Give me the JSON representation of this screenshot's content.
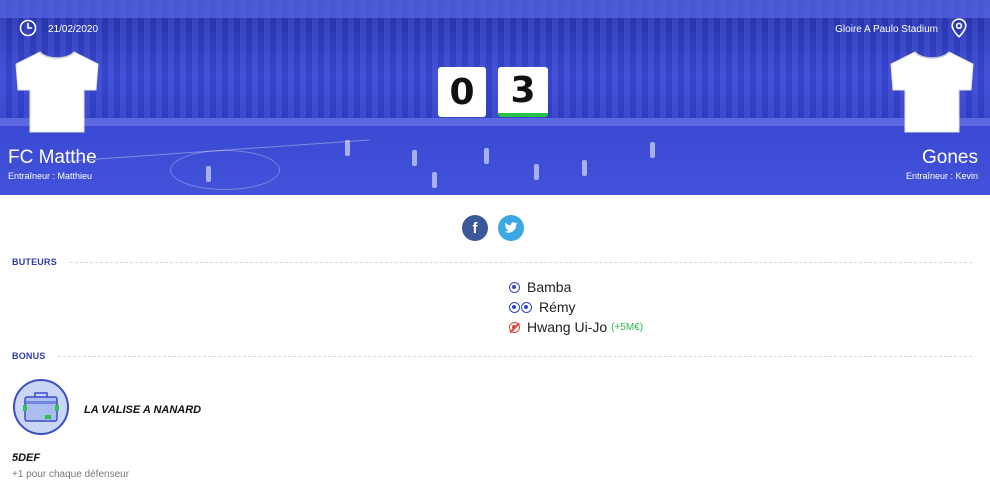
{
  "match": {
    "date": "21/02/2020",
    "stadium": "Gloire A Paulo Stadium",
    "home": {
      "name": "FC Matthe",
      "coach": "Entraîneur : Matthieu",
      "score": "0"
    },
    "away": {
      "name": "Gones",
      "coach": "Entraîneur : Kevin",
      "score": "3"
    }
  },
  "sections": {
    "scorers_title": "BUTEURS",
    "bonus_title": "BONUS"
  },
  "scorers": [
    {
      "name": "Bamba",
      "goals": 1,
      "own_goal": false,
      "extra": ""
    },
    {
      "name": "Rémy",
      "goals": 2,
      "own_goal": false,
      "extra": ""
    },
    {
      "name": "Hwang Ui-Jo",
      "goals": 1,
      "own_goal": true,
      "extra": "(+5M€)"
    }
  ],
  "bonus": {
    "name": "LA VALISE A NANARD",
    "rule_title": "5DEF",
    "rule_desc": "+1 pour chaque défenseur"
  },
  "colors": {
    "hero_blue": "#3443d1",
    "accent_green": "#27c24c",
    "section_blue": "#2f3ca8",
    "facebook": "#3b5998",
    "twitter": "#3ba8e4"
  },
  "icons": {
    "date": "clock-icon",
    "stadium": "location-pin-icon",
    "goal": "soccer-ball-icon",
    "own_goal": "own-goal-icon",
    "bonus": "briefcase-icon"
  }
}
